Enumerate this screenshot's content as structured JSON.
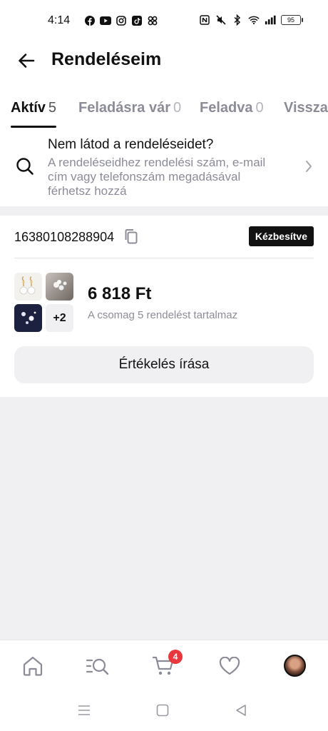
{
  "status_bar": {
    "time": "4:14",
    "battery": "95",
    "left_icons": [
      "facebook-icon",
      "youtube-icon",
      "instagram-icon",
      "tiktok-icon",
      "pinwheel-icon"
    ],
    "right_icons": [
      "nfc-icon",
      "mute-icon",
      "bluetooth-icon",
      "wifi-icon",
      "signal-icon",
      "battery-icon"
    ]
  },
  "header": {
    "title": "Rendeléseim"
  },
  "tabs": [
    {
      "label": "Aktív",
      "count": "5",
      "active": true
    },
    {
      "label": "Feladásra vár",
      "count": "0",
      "active": false
    },
    {
      "label": "Feladva",
      "count": "0",
      "active": false
    },
    {
      "label": "Visszat",
      "count": "",
      "active": false
    }
  ],
  "hint": {
    "title": "Nem látod a rendeléseidet?",
    "description": "A rendeléseidhez rendelési szám, e-mail cím vagy telefonszám megadásával férhetsz hozzá"
  },
  "order": {
    "id": "16380108288904",
    "status": "Kézbesítve",
    "more_count": "+2",
    "price": "6 818 Ft",
    "package_info": "A csomag 5 rendelést tartalmaz",
    "review_button": "Értékelés írása"
  },
  "bottom_nav": {
    "items": [
      "home-icon",
      "categories-search-icon",
      "cart-icon",
      "wishlist-heart-icon",
      "profile-avatar"
    ],
    "cart_badge": "4"
  },
  "colors": {
    "accent": "#111111",
    "muted_text": "#8c8c99",
    "badge_red": "#e8383d",
    "background": "#f0f0f3"
  }
}
